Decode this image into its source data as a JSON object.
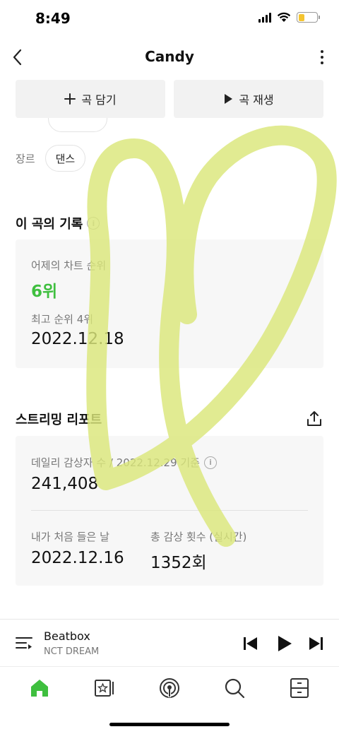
{
  "status": {
    "time": "8:49"
  },
  "header": {
    "title": "Candy"
  },
  "actions": {
    "add_label": "곡 담기",
    "play_label": "곡 재생"
  },
  "genre": {
    "label": "장르",
    "value": "댄스"
  },
  "record": {
    "title": "이 곡의 기록",
    "yesterday_label": "어제의 차트 순위",
    "yesterday_rank": "6위",
    "peak_label": "최고 순위 4위",
    "peak_date": "2022.12.18"
  },
  "streaming": {
    "title": "스트리밍 리포트",
    "daily_label": "데일리 감상자 수 / 2022.12.29 기준",
    "daily_value": "241,408",
    "first_listen_label": "내가 처음 들은 날",
    "first_listen_value": "2022.12.16",
    "total_label": "총 감상 횟수 (실시간)",
    "total_value": "1352회"
  },
  "player": {
    "title": "Beatbox",
    "artist": "NCT DREAM"
  },
  "colors": {
    "accent": "#3fbf3f",
    "highlight": "#dbe77a"
  }
}
